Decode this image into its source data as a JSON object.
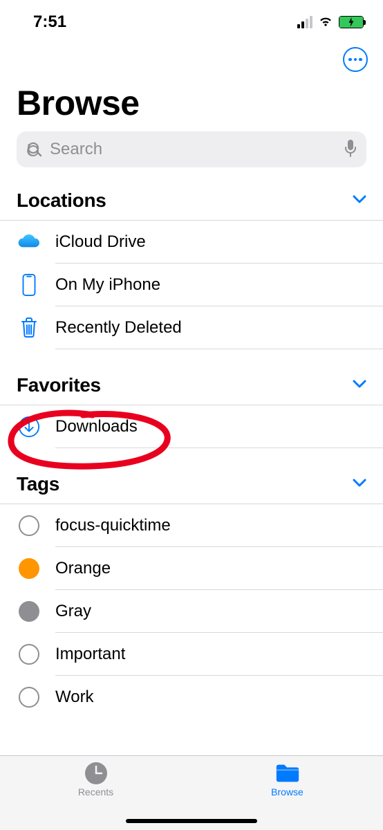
{
  "status_bar": {
    "time": "7:51"
  },
  "header": {
    "title": "Browse"
  },
  "search": {
    "placeholder": "Search"
  },
  "sections": {
    "locations": {
      "title": "Locations",
      "items": [
        {
          "label": "iCloud Drive",
          "icon": "cloud-icon"
        },
        {
          "label": "On My iPhone",
          "icon": "phone-icon"
        },
        {
          "label": "Recently Deleted",
          "icon": "trash-icon"
        }
      ]
    },
    "favorites": {
      "title": "Favorites",
      "items": [
        {
          "label": "Downloads",
          "icon": "download-icon"
        }
      ]
    },
    "tags": {
      "title": "Tags",
      "items": [
        {
          "label": "focus-quicktime",
          "color": "outline"
        },
        {
          "label": "Orange",
          "color": "orange"
        },
        {
          "label": "Gray",
          "color": "gray"
        },
        {
          "label": "Important",
          "color": "outline"
        },
        {
          "label": "Work",
          "color": "outline"
        }
      ]
    }
  },
  "tab_bar": {
    "recents": "Recents",
    "browse": "Browse"
  },
  "colors": {
    "accent": "#007aff",
    "orange": "#ff9500",
    "gray": "#8e8e93",
    "annotation": "#e8001f",
    "battery_green": "#34c759"
  }
}
